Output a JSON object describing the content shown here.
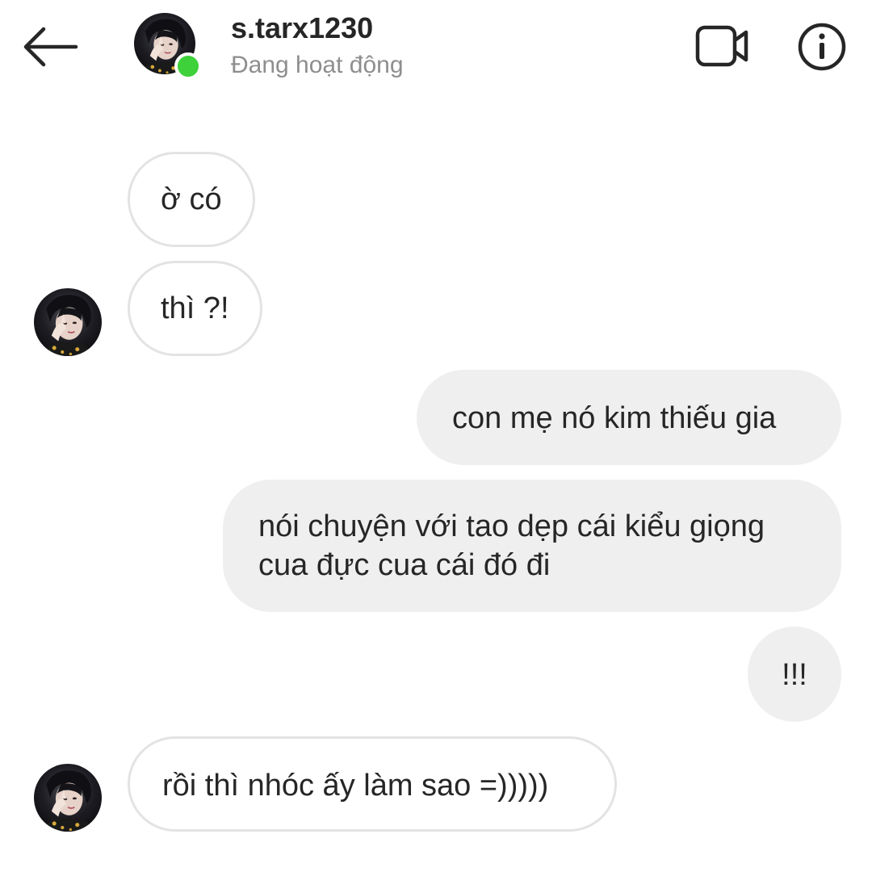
{
  "header": {
    "username": "s.tarx1230",
    "status": "Đang hoạt động",
    "icons": {
      "back": "arrow-left-icon",
      "video": "video-call-icon",
      "info": "info-icon"
    },
    "online_color": "#3ed13a"
  },
  "messages": [
    {
      "side": "in",
      "text": "ờ có"
    },
    {
      "side": "in",
      "text": "thì ?!"
    },
    {
      "side": "out",
      "text": "con mẹ nó kim thiếu gia"
    },
    {
      "side": "out",
      "lines": [
        "nói chuyện với tao dẹp cái kiểu giọng",
        "cua đực cua cái đó đi"
      ]
    },
    {
      "side": "out",
      "text": "!!!"
    },
    {
      "side": "in",
      "text": "rồi thì nhóc ấy làm sao =)))))"
    }
  ],
  "colors": {
    "outgoing_bubble": "#efefef",
    "incoming_border": "#e3e3e3",
    "status_text": "#8e8e8e"
  }
}
